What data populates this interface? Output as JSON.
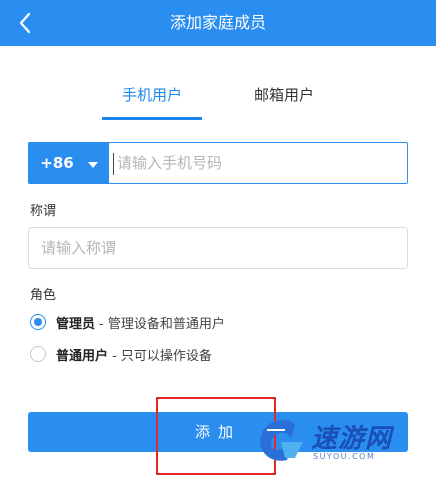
{
  "header": {
    "title": "添加家庭成员",
    "back_icon": "chevron-left-icon"
  },
  "tabs": [
    {
      "label": "手机用户",
      "active": true
    },
    {
      "label": "邮箱用户",
      "active": false
    }
  ],
  "phone": {
    "country_code": "+86",
    "placeholder": "请输入手机号码",
    "value": ""
  },
  "nickname": {
    "label": "称谓",
    "placeholder": "请输入称谓",
    "value": ""
  },
  "role": {
    "label": "角色",
    "options": [
      {
        "name": "管理员",
        "desc": "- 管理设备和普通用户",
        "checked": true
      },
      {
        "name": "普通用户",
        "desc": "- 只可以操作设备",
        "checked": false
      }
    ]
  },
  "add_button": {
    "label": "添加"
  },
  "colors": {
    "primary": "#2a8df0",
    "highlight_border": "#e02a2a",
    "watermark": "#1a4fb5"
  },
  "watermark": {
    "brand": "速游网",
    "sub": "SUYOU.COM"
  }
}
